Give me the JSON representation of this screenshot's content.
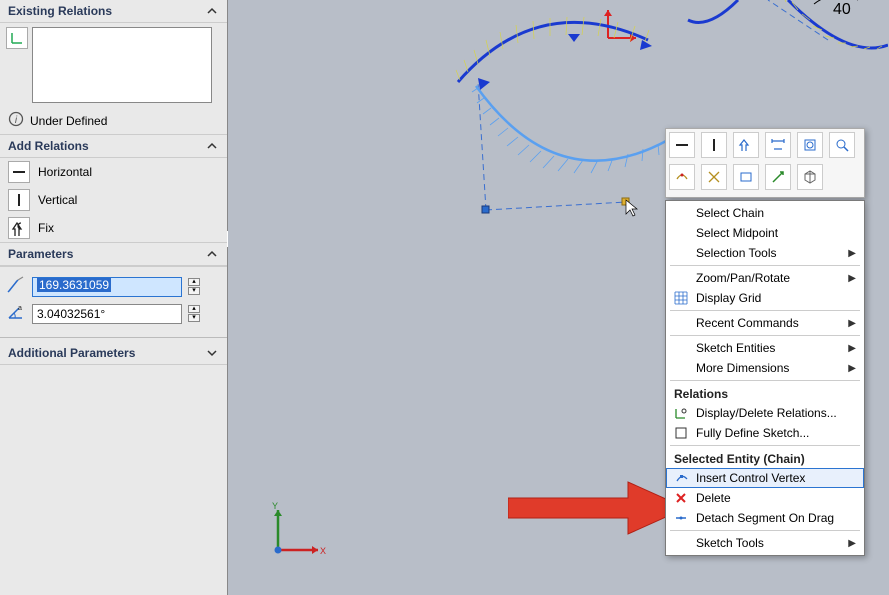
{
  "panel": {
    "existing_relations": {
      "title": "Existing Relations"
    },
    "status": {
      "label": "Under Defined"
    },
    "add_relations": {
      "title": "Add Relations",
      "items": [
        {
          "label": "Horizontal"
        },
        {
          "label": "Vertical"
        },
        {
          "label": "Fix"
        }
      ]
    },
    "parameters": {
      "title": "Parameters",
      "param1": "169.3631059",
      "param2": "3.04032561°"
    },
    "additional": {
      "title": "Additional Parameters"
    }
  },
  "canvas": {
    "axis": {
      "x": "X",
      "y": "Y"
    },
    "angle_label": "40"
  },
  "context_toolbar": {
    "icons": [
      "horizontal",
      "vertical",
      "fix",
      "dimension",
      "zoom-fit",
      "zoom-area",
      "convert",
      "trim",
      "rectangle",
      "exit",
      "view"
    ]
  },
  "context_menu": {
    "items": [
      {
        "label": "Select Chain",
        "type": "item"
      },
      {
        "label": "Select Midpoint",
        "type": "item"
      },
      {
        "label": "Selection Tools",
        "type": "sub"
      },
      {
        "label": "Zoom/Pan/Rotate",
        "type": "sub"
      },
      {
        "label": "Display Grid",
        "icon": "grid",
        "type": "item"
      },
      {
        "label": "Recent Commands",
        "type": "sub"
      },
      {
        "label": "Sketch Entities",
        "type": "sub"
      },
      {
        "label": "More Dimensions",
        "type": "sub"
      }
    ],
    "relations_header": "Relations",
    "relations_items": [
      {
        "label": "Display/Delete Relations...",
        "icon": "relations"
      },
      {
        "label": "Fully Define Sketch...",
        "icon": "fullydef"
      }
    ],
    "selected_entity_header": "Selected Entity (Chain)",
    "selected_items": [
      {
        "label": "Insert Control Vertex",
        "icon": "insert-vertex",
        "highlight": true
      },
      {
        "label": "Delete",
        "icon": "delete"
      },
      {
        "label": "Detach Segment On Drag",
        "icon": "detach"
      },
      {
        "label": "Sketch Tools",
        "type": "sub"
      }
    ]
  }
}
